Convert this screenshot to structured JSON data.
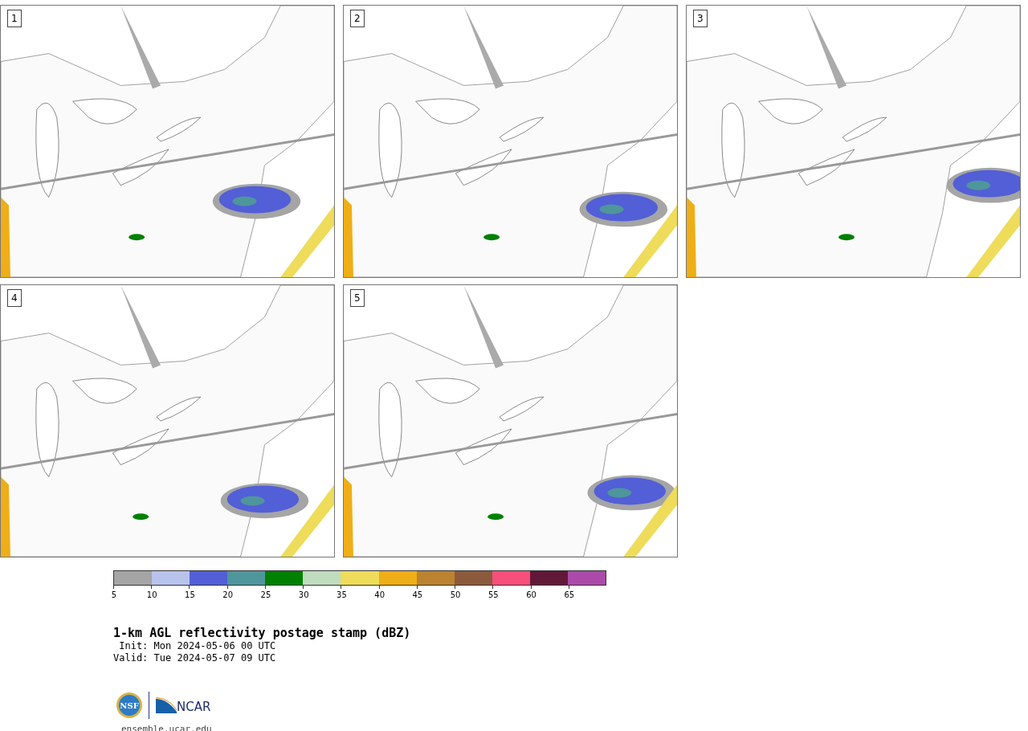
{
  "panels": [
    {
      "label": "1"
    },
    {
      "label": "2"
    },
    {
      "label": "3"
    },
    {
      "label": "4"
    },
    {
      "label": "5"
    }
  ],
  "colorbar": {
    "bins": [
      {
        "label": "5",
        "color": "#a5a5a5"
      },
      {
        "label": "10",
        "color": "#b8c3ec"
      },
      {
        "label": "15",
        "color": "#525fd6"
      },
      {
        "label": "20",
        "color": "#4f969c"
      },
      {
        "label": "25",
        "color": "#008000"
      },
      {
        "label": "30",
        "color": "#bfdcbe"
      },
      {
        "label": "35",
        "color": "#eedc5a"
      },
      {
        "label": "40",
        "color": "#efae17"
      },
      {
        "label": "45",
        "color": "#bb8330"
      },
      {
        "label": "50",
        "color": "#8b5a3c"
      },
      {
        "label": "55",
        "color": "#f64f7c"
      },
      {
        "label": "60",
        "color": "#621837"
      },
      {
        "label": "65",
        "color": "#ab4aa9"
      }
    ]
  },
  "title": "1-km AGL reflectivity postage stamp (dBZ)",
  "init": " Init: Mon 2024-05-06 00 UTC",
  "valid": "Valid: Tue 2024-05-07 09 UTC",
  "logo": {
    "seal_text": "NSF",
    "wordmark": "NCAR"
  },
  "footer_link": "ensemble.ucar.edu"
}
